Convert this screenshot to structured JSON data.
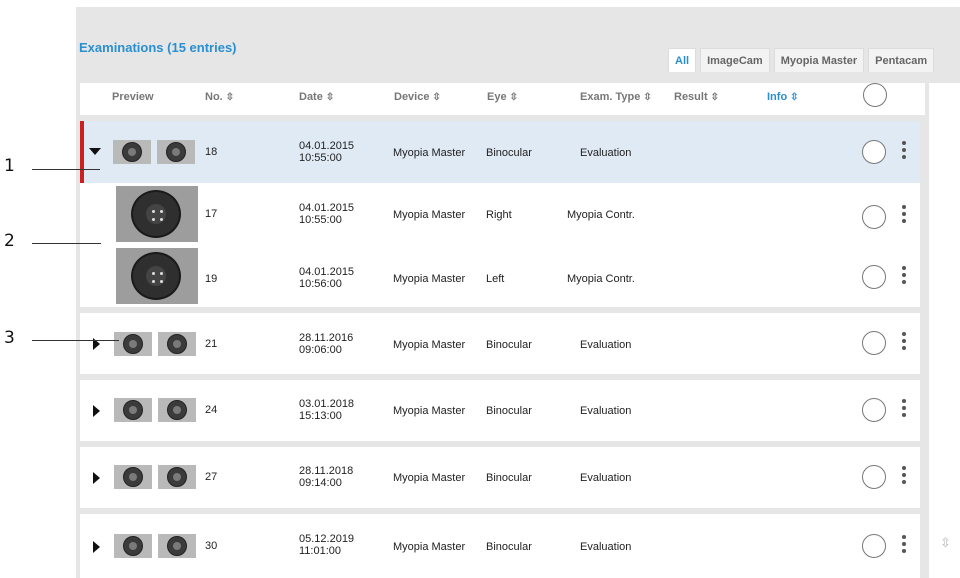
{
  "header": {
    "title": "Examinations (15 entries)",
    "tabs": [
      {
        "label": "All",
        "active": true
      },
      {
        "label": "ImageCam",
        "active": false
      },
      {
        "label": "Myopia Master",
        "active": false
      },
      {
        "label": "Pentacam",
        "active": false
      }
    ]
  },
  "columns": {
    "preview": "Preview",
    "no": "No.",
    "date": "Date",
    "device": "Device",
    "eye": "Eye",
    "exam_type": "Exam. Type",
    "result": "Result",
    "info": "Info"
  },
  "rows": [
    {
      "no": "18",
      "date": "04.01.2015",
      "time": "10:55:00",
      "device": "Myopia Master",
      "eye": "Binocular",
      "exam_type": "Evaluation",
      "expanded": true,
      "selected": true
    },
    {
      "no": "17",
      "date": "04.01.2015",
      "time": "10:55:00",
      "device": "Myopia Master",
      "eye": "Right",
      "exam_type": "Myopia Contr.",
      "child": true
    },
    {
      "no": "19",
      "date": "04.01.2015",
      "time": "10:56:00",
      "device": "Myopia Master",
      "eye": "Left",
      "exam_type": "Myopia Contr.",
      "child": true
    },
    {
      "no": "21",
      "date": "28.11.2016",
      "time": "09:06:00",
      "device": "Myopia Master",
      "eye": "Binocular",
      "exam_type": "Evaluation"
    },
    {
      "no": "24",
      "date": "03.01.2018",
      "time": "15:13:00",
      "device": "Myopia Master",
      "eye": "Binocular",
      "exam_type": "Evaluation"
    },
    {
      "no": "27",
      "date": "28.11.2018",
      "time": "09:14:00",
      "device": "Myopia Master",
      "eye": "Binocular",
      "exam_type": "Evaluation"
    },
    {
      "no": "30",
      "date": "05.12.2019",
      "time": "11:01:00",
      "device": "Myopia Master",
      "eye": "Binocular",
      "exam_type": "Evaluation"
    }
  ],
  "callouts": [
    "1",
    "2",
    "3"
  ],
  "icons": {
    "sort": "sort-updown-icon",
    "expand": "triangle-right-icon",
    "collapse": "triangle-down-icon",
    "select": "circle-select-icon",
    "menu": "kebab-menu-icon"
  },
  "colors": {
    "accent": "#2a8fd1",
    "selected_row": "#dfeaf5",
    "selection_marker": "#cc1f1f"
  }
}
